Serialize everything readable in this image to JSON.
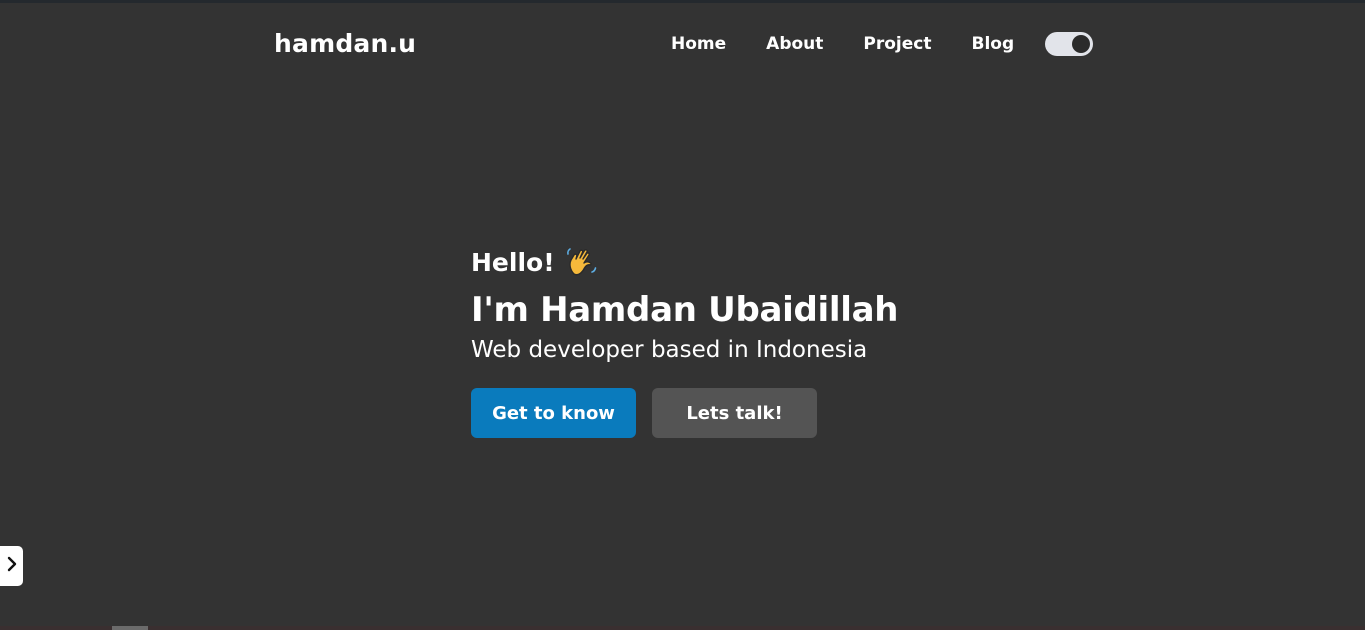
{
  "navbar": {
    "logo": "hamdan.u",
    "links": [
      "Home",
      "About",
      "Project",
      "Blog"
    ],
    "theme_toggle": {
      "icon": "theme-toggle",
      "state": "dark"
    }
  },
  "hero": {
    "greeting": "Hello!",
    "greeting_icon": "waving-hand-icon",
    "name": "I'm Hamdan Ubaidillah",
    "tagline": "Web developer based in Indonesia",
    "primary_button": "Get to know",
    "secondary_button": "Lets talk!"
  },
  "side_tab": {
    "icon": "chevron-right-icon"
  },
  "colors": {
    "background": "#333333",
    "primary_button": "#0a7bbd",
    "secondary_button": "#545454",
    "text": "#ffffff"
  }
}
